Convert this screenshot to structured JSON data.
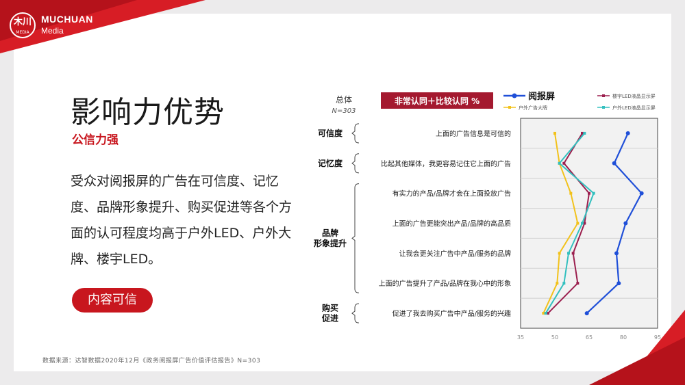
{
  "brand": {
    "logo_text": "木川",
    "logo_sub": "MEDIA",
    "name": "MUCHUAN",
    "tagline": "Media"
  },
  "page": {
    "title": "影响力优势",
    "subtitle": "公信力强",
    "body": "受众对阅报屏的广告在可信度、记忆度、品牌形象提升、购买促进等各个方面的认可程度均高于户外LED、户外大牌、楼宇LED。",
    "pill": "内容可信",
    "source": "数据来源：达智数据2020年12月《政务阅报屏广告价值评估报告》N=303"
  },
  "chart_data": {
    "type": "line",
    "orientation": "horizontal",
    "sample_label": "总体",
    "sample_size": "N=303",
    "metric_label": "非常认同＋比较认同  %",
    "groups": [
      {
        "label": "可信度",
        "rows": [
          0
        ]
      },
      {
        "label": "记忆度",
        "rows": [
          1
        ]
      },
      {
        "label": "品牌\n形象提升",
        "rows": [
          2,
          3,
          4,
          5
        ]
      },
      {
        "label": "购买\n促进",
        "rows": [
          6
        ]
      }
    ],
    "categories": [
      "上面的广告信息是可信的",
      "比起其他媒体，我更容易记住它上面的广告",
      "有实力的产品/品牌才会在上面投放广告",
      "上面的广告更能突出产品/品牌的高品质",
      "让我会更关注广告中产品/服务的品牌",
      "上面的广告提升了产品/品牌在我心中的形象",
      "促进了我去购买广告中产品/服务的兴趣"
    ],
    "xlim": [
      35,
      95
    ],
    "xticks": [
      "35",
      "50",
      "65",
      "80",
      "95"
    ],
    "series": [
      {
        "name": "阅报屏",
        "color": "#1f4fd8",
        "values": [
          82,
          76,
          88,
          81,
          77,
          78,
          64
        ]
      },
      {
        "name": "楼宇LED液晶显示屏",
        "color": "#9b1f4e",
        "values": [
          62,
          54,
          65,
          63,
          58,
          60,
          47
        ]
      },
      {
        "name": "户外广告大牌",
        "color": "#f2c21b",
        "values": [
          50,
          52,
          57,
          60,
          52,
          51,
          45
        ]
      },
      {
        "name": "户外LED液晶显示屏",
        "color": "#33c0bf",
        "values": [
          63,
          52,
          67,
          62,
          56,
          54,
          46
        ]
      }
    ]
  }
}
